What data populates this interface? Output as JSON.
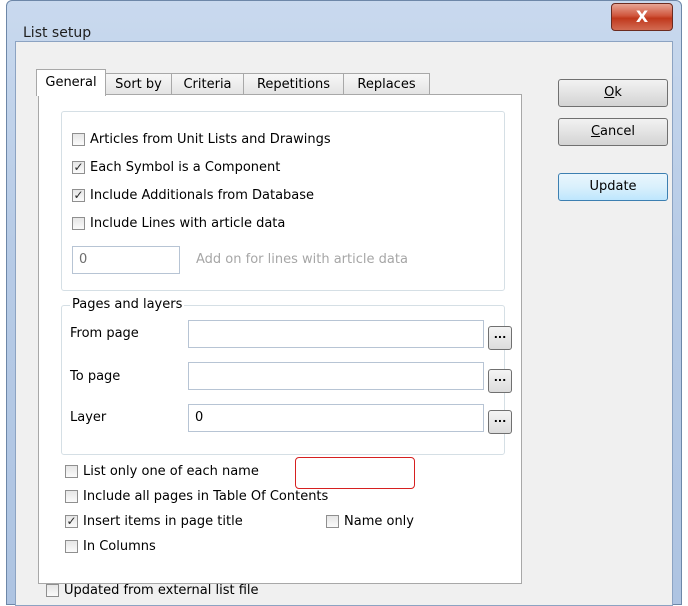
{
  "window": {
    "title": "List setup",
    "close_label": "X"
  },
  "tabs": [
    "General",
    "Sort by",
    "Criteria",
    "Repetitions",
    "Replaces"
  ],
  "general": {
    "options": [
      {
        "label": "Articles from Unit Lists and Drawings",
        "checked": false
      },
      {
        "label": "Each Symbol is a Component",
        "checked": true
      },
      {
        "label": "Include Additionals from Database",
        "checked": true
      },
      {
        "label": "Include Lines with article data",
        "checked": false
      }
    ],
    "addon": {
      "value": "0",
      "label": "Add on for lines with article data"
    },
    "pages_layers": {
      "title": "Pages and layers",
      "from_page_label": "From page",
      "from_page_value": "",
      "to_page_label": "To page",
      "to_page_value": "",
      "layer_label": "Layer",
      "layer_value": "0",
      "browse_label": "..."
    },
    "list_only_one": {
      "label": "List only one of each name",
      "checked": false
    },
    "include_toc": {
      "label": "Include all pages in Table Of Contents",
      "checked": false
    },
    "insert_title": {
      "label": "Insert items in page title",
      "checked": true
    },
    "name_only": {
      "label": "Name only",
      "checked": false
    },
    "in_columns": {
      "label": "In Columns",
      "checked": false
    }
  },
  "footer": {
    "updated_from_external": {
      "label": "Updated from external list file",
      "checked": false
    }
  },
  "buttons": {
    "ok": {
      "mnemonic": "O",
      "rest": "k"
    },
    "cancel": {
      "mnemonic": "C",
      "rest": "ancel"
    },
    "update": "Update"
  },
  "checkmark_glyph": "✓"
}
